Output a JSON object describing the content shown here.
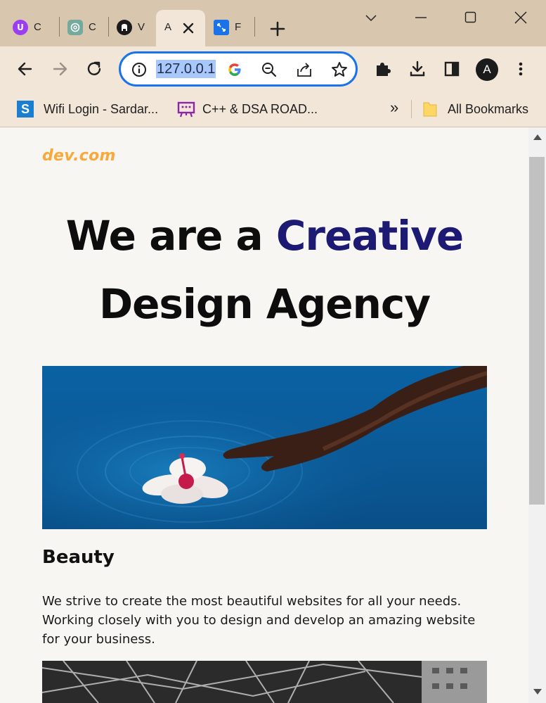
{
  "browser": {
    "tabs": [
      {
        "label": "C",
        "icon": "u-app-icon",
        "color": "#9b3df0"
      },
      {
        "label": "C",
        "icon": "chatgpt-icon",
        "color": "#74aa9c"
      },
      {
        "label": "V",
        "icon": "github-icon",
        "color": "#1b1b1b"
      },
      {
        "label": "A",
        "icon": "page-icon",
        "active": true
      },
      {
        "label": "F",
        "icon": "resize-app-icon",
        "color": "#1a73e8"
      }
    ],
    "address": "127.0.0.1",
    "profile_initial": "A",
    "bookmarks": [
      {
        "label": "Wifi Login - Sardar...",
        "icon": "s-favicon-icon"
      },
      {
        "label": "C++ & DSA ROAD...",
        "icon": "presentation-icon"
      }
    ],
    "overflow_label": "»",
    "all_bookmarks_label": "All Bookmarks"
  },
  "page": {
    "logo": "dev.com",
    "hero_line1_prefix": "We are a ",
    "hero_accent": "Creative",
    "hero_line2": "Design Agency",
    "section_title": "Beauty",
    "section_body": "We strive to create the most beautiful websites for all your needs. Working closely with you to design and develop an amazing website for your business."
  },
  "colors": {
    "accent_navy": "#1c1a73",
    "logo_orange": "#f9a83a",
    "chrome_frame": "#d8c6ae",
    "chrome_toolbar": "#f1e6d7",
    "focus_blue": "#1a73e8"
  }
}
